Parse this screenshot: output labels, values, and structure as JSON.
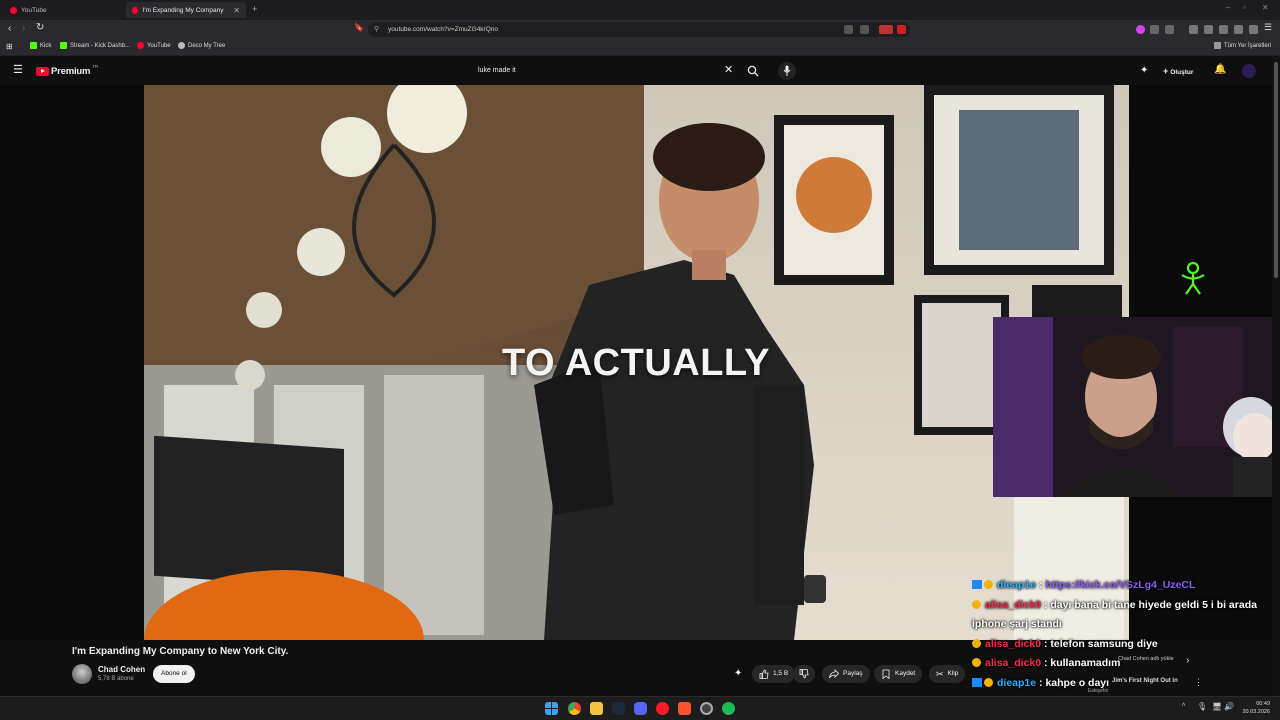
{
  "browser": {
    "tabs": [
      {
        "title": "YouTube",
        "active": false
      },
      {
        "title": "I'm Expanding My Company to N",
        "active": true
      }
    ],
    "url": "youtube.com/watch?v=ZmuZG4krQno",
    "bookmarks": [
      "Kick",
      "Stream - Kick Dashb...",
      "YouTube",
      "Deco My Tree"
    ],
    "all_bookmarks_label": "Tüm Yer İşaretleri"
  },
  "youtube": {
    "brand": "Premium",
    "region": "TR",
    "search_value": "luke made it",
    "create_label": "Oluştur"
  },
  "video": {
    "caption": "TO ACTUALLY",
    "title": "I'm Expanding My Company to New York City.",
    "channel": "Chad Cohen",
    "subscribers": "5,78 B abone",
    "subscribe_label": "Abone ol",
    "likes": "1,5 B",
    "share_label": "Paylaş",
    "save_label": "Kaydet",
    "clip_label": "Klip"
  },
  "chat": [
    {
      "user": "dieap1e",
      "text": "https://kick.co/VSzLg4_UzeCL",
      "user_color": "#2fb0ff",
      "text_color": "#8b5cf6"
    },
    {
      "user": "alisa_dick0",
      "text": "dayı bana bi tane hiyede geldi 5 i bi arada iphone şarj standı",
      "user_color": "#ff2a4a",
      "text_color": "#ffffff"
    },
    {
      "user": "alisa_dick0",
      "text": "telefon samsung diye",
      "user_color": "#ff2a4a",
      "text_color": "#ffffff"
    },
    {
      "user": "alisa_dick0",
      "text": "kullanamadım",
      "user_color": "#ff2a4a",
      "text_color": "#ffffff"
    },
    {
      "user": "dieap1e",
      "text": "kahpe o dayı",
      "user_color": "#2fb0ff",
      "text_color": "#ffffff"
    }
  ],
  "recommendation": {
    "title_fragment": "Chad Cohen adlı yükle",
    "video_title": "Jim's First Night Out in",
    "channel": "Eskişehir"
  },
  "taskbar": {
    "time": "00:49",
    "date": "20.03.2026"
  },
  "colors": {
    "youtube_red": "#ff0033",
    "kick_green": "#53fc18"
  }
}
